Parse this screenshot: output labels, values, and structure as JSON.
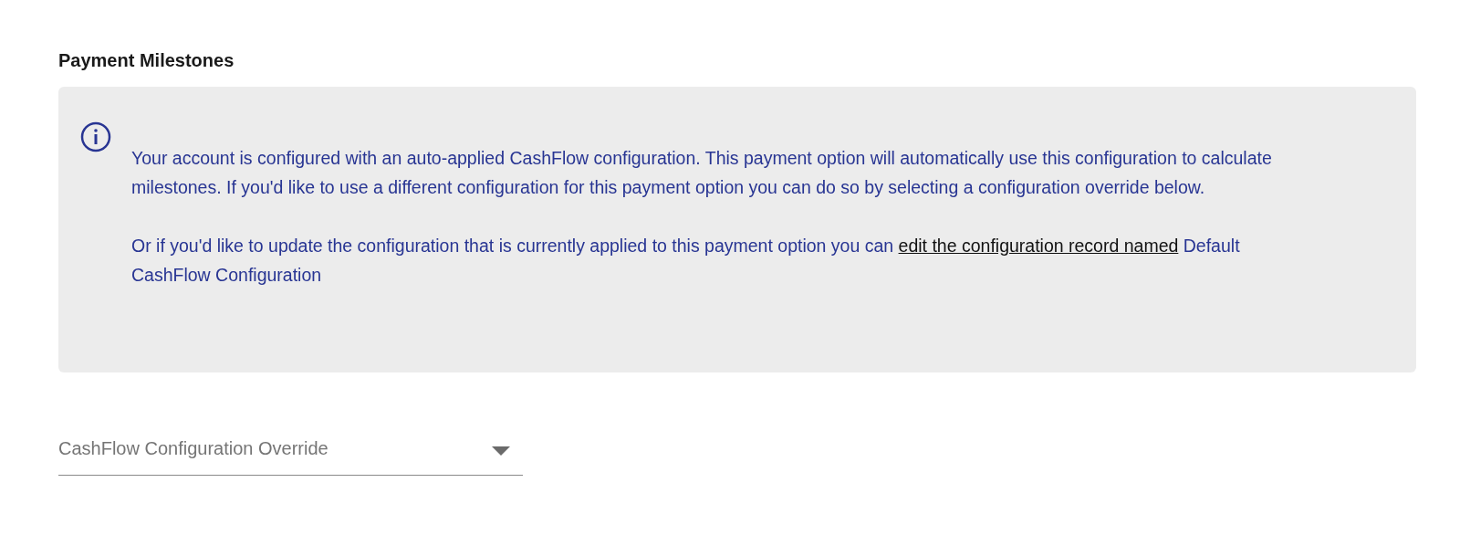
{
  "heading": "Payment Milestones",
  "info_panel": {
    "message": "Your account is configured with an auto-applied CashFlow configuration. This payment option will automatically use this configuration to calculate milestones. If you'd like to use a different configuration for this payment option you can do so by selecting a configuration override below.",
    "update_note": {
      "text": "Or if you'd like to update the configuration that is currently applied to this payment option you can",
      "link": "edit the configuration record named",
      "record_name": "Default CashFlow Configuration"
    }
  },
  "override_select": {
    "placeholder": "CashFlow Configuration Override"
  }
}
